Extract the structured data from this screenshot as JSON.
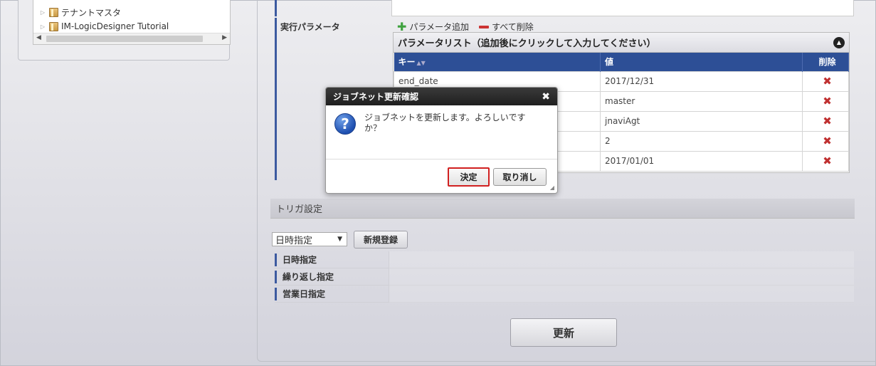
{
  "tree": {
    "items": [
      {
        "label": "テナントマスタ"
      },
      {
        "label": "IM-LogicDesigner Tutorial"
      }
    ]
  },
  "params": {
    "section_label": "実行パラメータ",
    "add_label": "パラメータ追加",
    "delete_all_label": "すべて削除",
    "list_title": "パラメータリスト（追加後にクリックして入力してください）",
    "columns": {
      "key": "キー",
      "value": "値",
      "delete": "削除"
    },
    "rows": [
      {
        "key": "end_date",
        "value": "2017/12/31"
      },
      {
        "key": "",
        "value": "master"
      },
      {
        "key": "",
        "value": "jnaviAgt"
      },
      {
        "key": "",
        "value": "2"
      },
      {
        "key": "",
        "value": "2017/01/01"
      }
    ],
    "delete_glyph": "✖"
  },
  "trigger": {
    "section_title": "トリガ設定",
    "select_value": "日時指定",
    "new_button": "新規登録",
    "rows": [
      {
        "label": "日時指定"
      },
      {
        "label": "繰り返し指定"
      },
      {
        "label": "営業日指定"
      }
    ]
  },
  "update_button": "更新",
  "dialog": {
    "title": "ジョブネット更新確認",
    "message": "ジョブネットを更新します。よろしいですか？",
    "ok": "決定",
    "cancel": "取り消し",
    "close_glyph": "✖",
    "icon_glyph": "?"
  },
  "colors": {
    "accent": "#2d4f96",
    "highlight": "#d12020"
  }
}
